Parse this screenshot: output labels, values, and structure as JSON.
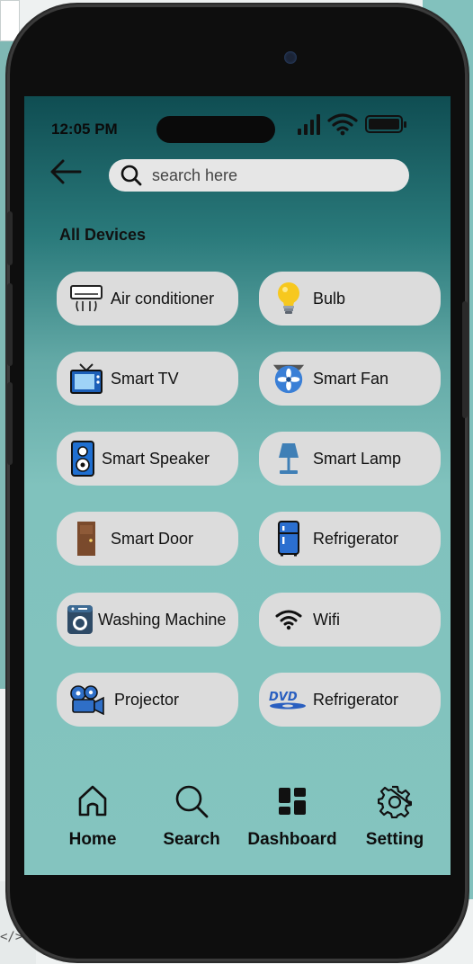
{
  "status_bar": {
    "time": "12:05 PM"
  },
  "search": {
    "placeholder": "search here"
  },
  "section_title": "All Devices",
  "devices": [
    {
      "label": "Air conditioner",
      "icon": "air-conditioner-icon"
    },
    {
      "label": "Bulb",
      "icon": "bulb-icon"
    },
    {
      "label": "Smart TV",
      "icon": "tv-icon"
    },
    {
      "label": "Smart Fan",
      "icon": "fan-icon"
    },
    {
      "label": "Smart Speaker",
      "icon": "speaker-icon"
    },
    {
      "label": "Smart Lamp",
      "icon": "lamp-icon"
    },
    {
      "label": "Smart Door",
      "icon": "door-icon"
    },
    {
      "label": "Refrigerator",
      "icon": "refrigerator-icon"
    },
    {
      "label": "Washing Machine",
      "icon": "washing-machine-icon"
    },
    {
      "label": "Wifi",
      "icon": "wifi-icon"
    },
    {
      "label": "Projector",
      "icon": "projector-icon"
    },
    {
      "label": "Refrigerator",
      "icon": "dvd-icon"
    }
  ],
  "nav": [
    {
      "label": "Home",
      "icon": "home-icon"
    },
    {
      "label": "Search",
      "icon": "search-icon"
    },
    {
      "label": "Dashboard",
      "icon": "dashboard-icon"
    },
    {
      "label": "Setting",
      "icon": "gear-icon"
    }
  ],
  "background": {
    "code_hint": "</>"
  },
  "colors": {
    "screen_top": "#0f4d52",
    "screen_bottom": "#84c4bf",
    "card": "#dcdcdc",
    "phone_frame": "#0e0e0e"
  }
}
